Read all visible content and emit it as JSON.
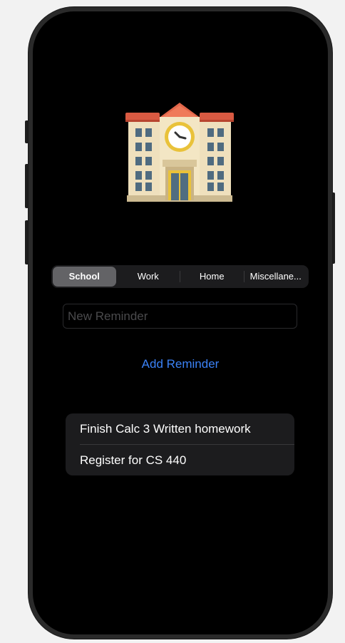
{
  "category_icon": "school-building-emoji",
  "tabs": [
    {
      "label": "School",
      "selected": true
    },
    {
      "label": "Work",
      "selected": false
    },
    {
      "label": "Home",
      "selected": false
    },
    {
      "label": "Miscellane...",
      "selected": false
    }
  ],
  "new_reminder": {
    "value": "",
    "placeholder": "New Reminder"
  },
  "add_button_label": "Add Reminder",
  "reminders": [
    "Finish Calc 3 Written homework",
    "Register for CS 440"
  ],
  "colors": {
    "accent": "#3b82f6",
    "screen_background": "#000000",
    "segment_selected": "#636366",
    "list_background": "#1c1c1e"
  }
}
